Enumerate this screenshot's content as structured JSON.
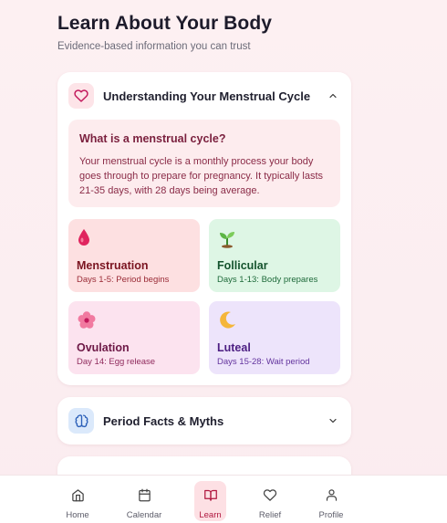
{
  "header": {
    "title": "Learn About Your Body",
    "subtitle": "Evidence-based information you can trust"
  },
  "sections": {
    "cycle": {
      "title": "Understanding Your Menstrual Cycle",
      "icon": "heart-icon",
      "expanded": true,
      "info": {
        "title": "What is a menstrual cycle?",
        "text": "Your menstrual cycle is a monthly process your body goes through to prepare for pregnancy. It typically lasts 21-35 days, with 28 days being average."
      },
      "phases": [
        {
          "emoji": "🩸",
          "name": "Menstruation",
          "desc": "Days 1-5: Period begins"
        },
        {
          "emoji": "🌱",
          "name": "Follicular",
          "desc": "Days 1-13: Body prepares"
        },
        {
          "emoji": "🌸",
          "name": "Ovulation",
          "desc": "Day 14: Egg release"
        },
        {
          "emoji": "🌙",
          "name": "Luteal",
          "desc": "Days 15-28: Wait period"
        }
      ]
    },
    "facts": {
      "title": "Period Facts & Myths",
      "icon": "brain-icon",
      "expanded": false
    }
  },
  "nav": {
    "items": [
      {
        "label": "Home",
        "icon": "home-icon"
      },
      {
        "label": "Calendar",
        "icon": "calendar-icon"
      },
      {
        "label": "Learn",
        "icon": "book-icon",
        "active": true
      },
      {
        "label": "Relief",
        "icon": "heart-icon"
      },
      {
        "label": "Profile",
        "icon": "user-icon"
      }
    ]
  },
  "colors": {
    "accent": "#b0173f",
    "background": "#fdf0f2"
  }
}
